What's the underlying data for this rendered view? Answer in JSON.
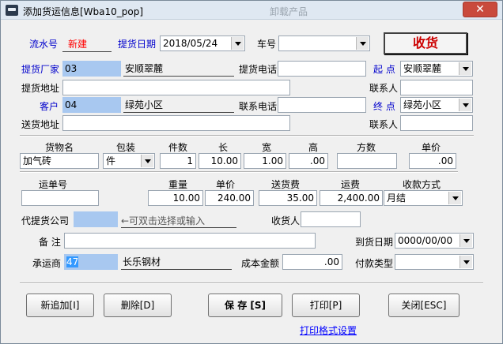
{
  "window": {
    "title": "添加货运信息[Wba10_pop]",
    "ghost_title": "卸载产品",
    "close_glyph": "✕"
  },
  "header": {
    "serial_label": "流水号",
    "serial_value": "新建",
    "pickup_date_label": "提货日期",
    "pickup_date_value": "2018/05/24",
    "vehicle_label": "车号",
    "vehicle_value": "",
    "receive_button": "收货"
  },
  "shipper": {
    "factory_label": "提货厂家",
    "factory_code": "03",
    "factory_name": "安顺翠麓",
    "phone_label": "提货电话",
    "phone_value": "",
    "origin_label": "起 点",
    "origin_value": "安顺翠麓",
    "address_label": "提货地址",
    "address_value": "",
    "contact_label": "联系人",
    "contact_value": ""
  },
  "customer": {
    "customer_label": "客户",
    "customer_code": "04",
    "customer_name": "绿苑小区",
    "phone_label": "联系电话",
    "phone_value": "",
    "dest_label": "终 点",
    "dest_value": "绿苑小区",
    "address_label": "送货地址",
    "address_value": "",
    "contact_label": "联系人",
    "contact_value": ""
  },
  "goods": {
    "headers": {
      "name": "货物名",
      "package": "包装",
      "count": "件数",
      "length": "长",
      "width": "宽",
      "height": "高",
      "volume": "方数",
      "unit_price": "单价"
    },
    "name": "加气砖",
    "package": "件",
    "count": "1",
    "length": "10.00",
    "width": "1.00",
    "height": ".00",
    "volume": "",
    "unit_price": ".00"
  },
  "freight": {
    "headers": {
      "waybill": "运单号",
      "weight": "重量",
      "unit_price": "单价",
      "delivery_fee": "送货费",
      "freight_fee": "运费",
      "payment_method": "收款方式"
    },
    "waybill": "",
    "weight": "10.00",
    "unit_price": "240.00",
    "delivery_fee": "35.00",
    "freight_fee": "2,400.00",
    "payment_method": "月结"
  },
  "agent": {
    "agent_label": "代提货公司",
    "agent_value": "",
    "agent_hint": "←可双击选择或输入",
    "receiver_label": "收货人",
    "receiver_value": "",
    "remark_label": "备 注",
    "remark_value": "",
    "arrival_date_label": "到货日期",
    "arrival_date_value": "0000/00/00",
    "carrier_label": "承运商",
    "carrier_code": "47",
    "carrier_name": "长乐钢材",
    "cost_label": "成本金额",
    "cost_value": ".00",
    "payment_type_label": "付款类型",
    "payment_type_value": ""
  },
  "actions": {
    "add": "新追加[I]",
    "delete": "删除[D]",
    "save": "保 存 [S]",
    "print": "打印[P]",
    "close": "关闭[ESC]",
    "print_settings": "打印格式设置"
  }
}
